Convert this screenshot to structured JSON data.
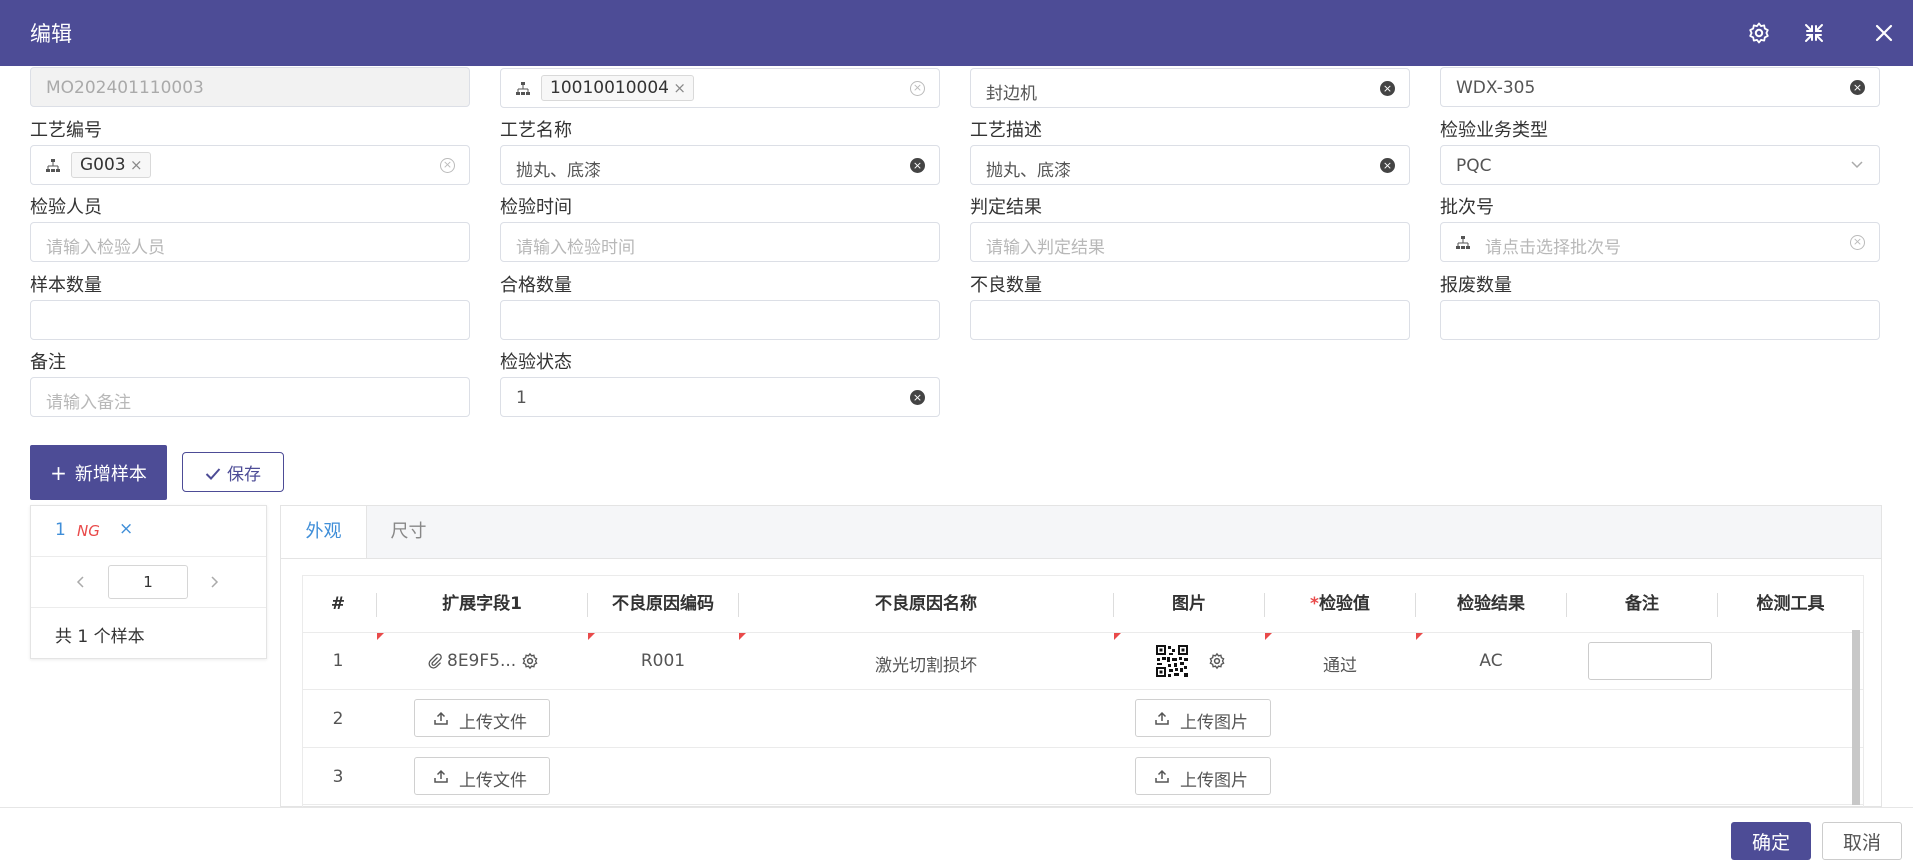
{
  "dialog": {
    "title": "编辑"
  },
  "form": {
    "order_no": "MO202401110003",
    "material_tag": "10010010004",
    "device_name": "封边机",
    "device_model": "WDX-305",
    "process_code": {
      "label": "工艺编号",
      "tag": "G003"
    },
    "process_name": {
      "label": "工艺名称",
      "value": "抛丸、底漆"
    },
    "process_desc": {
      "label": "工艺描述",
      "value": "抛丸、底漆"
    },
    "inspect_type": {
      "label": "检验业务类型",
      "value": "PQC"
    },
    "inspector": {
      "label": "检验人员",
      "placeholder": "请输入检验人员"
    },
    "inspect_time": {
      "label": "检验时间",
      "placeholder": "请输入检验时间"
    },
    "judge_result": {
      "label": "判定结果",
      "placeholder": "请输入判定结果"
    },
    "batch_no": {
      "label": "批次号",
      "placeholder": "请点击选择批次号"
    },
    "sample_qty": {
      "label": "样本数量"
    },
    "pass_qty": {
      "label": "合格数量"
    },
    "bad_qty": {
      "label": "不良数量"
    },
    "scrap_qty": {
      "label": "报废数量"
    },
    "remark": {
      "label": "备注",
      "placeholder": "请输入备注"
    },
    "inspect_status": {
      "label": "检验状态",
      "value": "1"
    }
  },
  "actions": {
    "add_sample": "新增样本",
    "save": "保存"
  },
  "samples": {
    "item_no": "1",
    "item_status": "NG",
    "item_close": "×",
    "page": "1",
    "total": "共 1 个样本"
  },
  "tabs": [
    "外观",
    "尺寸"
  ],
  "table": {
    "headers": [
      "#",
      "扩展字段1",
      "不良原因编码",
      "不良原因名称",
      "图片",
      "检验值",
      "检验结果",
      "备注",
      "检测工具"
    ],
    "required_mark": "*",
    "rows": [
      {
        "no": "1",
        "ext": "8E9F5...",
        "code": "R001",
        "name": "激光切割损坏",
        "value": "通过",
        "result": "AC"
      },
      {
        "no": "2",
        "upload_file": "上传文件",
        "upload_image": "上传图片"
      },
      {
        "no": "3",
        "upload_file": "上传文件",
        "upload_image": "上传图片"
      }
    ]
  },
  "footer": {
    "ok": "确定",
    "cancel": "取消"
  },
  "colors": {
    "primary": "#4d4c96",
    "tab_active": "#3f8ed8",
    "ng": "#e94a4a"
  }
}
